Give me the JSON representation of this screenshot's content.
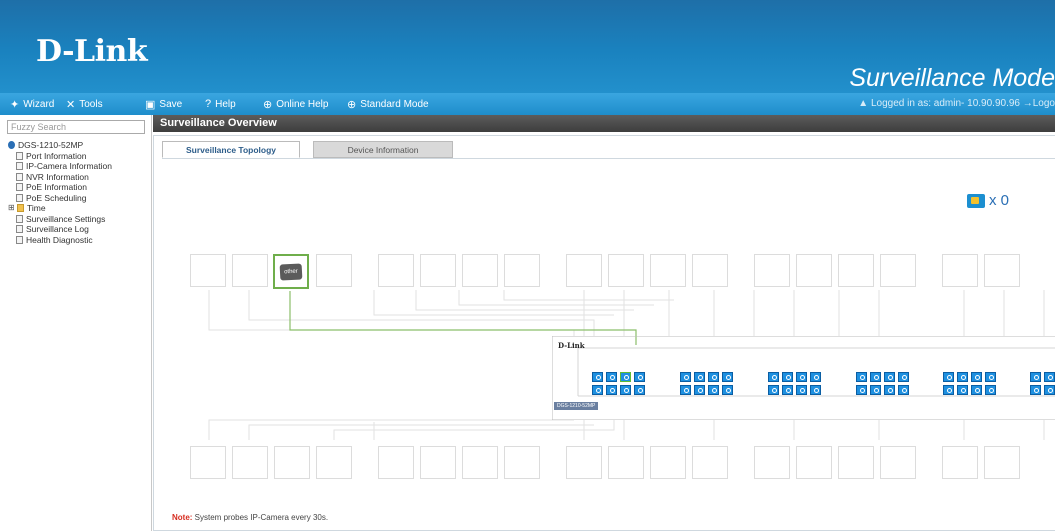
{
  "header": {
    "logo": "D-Link",
    "mode_title": "Surveillance Mode"
  },
  "toolbar": {
    "items": [
      {
        "label": "Wizard",
        "icon": "wand-icon"
      },
      {
        "label": "Tools",
        "icon": "tools-icon"
      },
      {
        "label": "Save",
        "icon": "save-icon"
      },
      {
        "label": "Help",
        "icon": "help-icon"
      },
      {
        "label": "Online Help",
        "icon": "globe-icon"
      },
      {
        "label": "Standard Mode",
        "icon": "globe-icon"
      }
    ],
    "login_text": "Logged in as: admin- 10.90.90.96",
    "logout_label": "Logo"
  },
  "sidebar": {
    "search_placeholder": "Fuzzy Search",
    "tree": {
      "root": "DGS-1210-52MP",
      "items": [
        {
          "label": "Port Information"
        },
        {
          "label": "IP-Camera Information"
        },
        {
          "label": "NVR Information"
        },
        {
          "label": "PoE Information"
        },
        {
          "label": "PoE Scheduling"
        }
      ],
      "folder": "Time",
      "items2": [
        {
          "label": "Surveillance Settings"
        },
        {
          "label": "Surveillance Log"
        },
        {
          "label": "Health Diagnostic"
        }
      ]
    }
  },
  "main": {
    "title": "Surveillance Overview",
    "tabs": [
      {
        "label": "Surveillance Topology",
        "active": true
      },
      {
        "label": "Device Information",
        "active": false
      }
    ],
    "camera_count_label": "x 0",
    "camera_icon_text": "IP Camera",
    "switch_logo": "D-Link",
    "switch_model": "DGS-1210-52MP",
    "device_chip_text": "other",
    "note_label": "Note:",
    "note_text": " System probes IP-Camera every 30s."
  },
  "colors": {
    "header_blue": "#1a82bf",
    "toolbar_blue": "#2b9ad6",
    "port_blue": "#1e90e0",
    "selected_green": "#6fae4b",
    "note_red": "#d62b1e"
  }
}
